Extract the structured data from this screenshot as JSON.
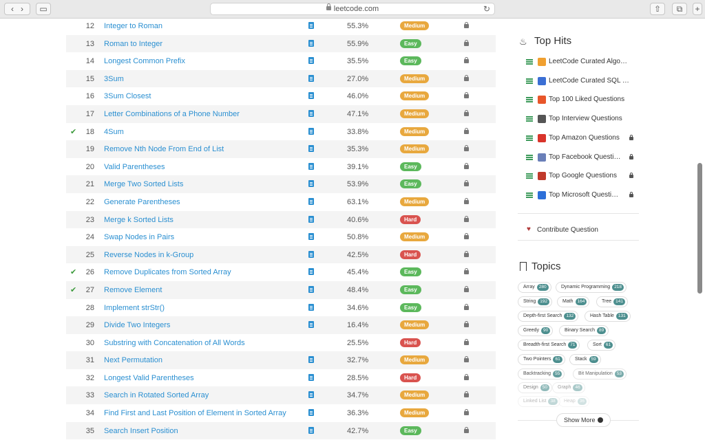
{
  "browser": {
    "url": "leetcode.com"
  },
  "problems": [
    {
      "num": "12",
      "title": "Integer to Roman",
      "acceptance": "55.3%",
      "difficulty": "Medium",
      "solved": false,
      "solution": true
    },
    {
      "num": "13",
      "title": "Roman to Integer",
      "acceptance": "55.9%",
      "difficulty": "Easy",
      "solved": false,
      "solution": true
    },
    {
      "num": "14",
      "title": "Longest Common Prefix",
      "acceptance": "35.5%",
      "difficulty": "Easy",
      "solved": false,
      "solution": true
    },
    {
      "num": "15",
      "title": "3Sum",
      "acceptance": "27.0%",
      "difficulty": "Medium",
      "solved": false,
      "solution": true
    },
    {
      "num": "16",
      "title": "3Sum Closest",
      "acceptance": "46.0%",
      "difficulty": "Medium",
      "solved": false,
      "solution": true
    },
    {
      "num": "17",
      "title": "Letter Combinations of a Phone Number",
      "acceptance": "47.1%",
      "difficulty": "Medium",
      "solved": false,
      "solution": true
    },
    {
      "num": "18",
      "title": "4Sum",
      "acceptance": "33.8%",
      "difficulty": "Medium",
      "solved": true,
      "solution": true
    },
    {
      "num": "19",
      "title": "Remove Nth Node From End of List",
      "acceptance": "35.3%",
      "difficulty": "Medium",
      "solved": false,
      "solution": true
    },
    {
      "num": "20",
      "title": "Valid Parentheses",
      "acceptance": "39.1%",
      "difficulty": "Easy",
      "solved": false,
      "solution": true
    },
    {
      "num": "21",
      "title": "Merge Two Sorted Lists",
      "acceptance": "53.9%",
      "difficulty": "Easy",
      "solved": false,
      "solution": true
    },
    {
      "num": "22",
      "title": "Generate Parentheses",
      "acceptance": "63.1%",
      "difficulty": "Medium",
      "solved": false,
      "solution": true
    },
    {
      "num": "23",
      "title": "Merge k Sorted Lists",
      "acceptance": "40.6%",
      "difficulty": "Hard",
      "solved": false,
      "solution": true
    },
    {
      "num": "24",
      "title": "Swap Nodes in Pairs",
      "acceptance": "50.8%",
      "difficulty": "Medium",
      "solved": false,
      "solution": true
    },
    {
      "num": "25",
      "title": "Reverse Nodes in k-Group",
      "acceptance": "42.5%",
      "difficulty": "Hard",
      "solved": false,
      "solution": true
    },
    {
      "num": "26",
      "title": "Remove Duplicates from Sorted Array",
      "acceptance": "45.4%",
      "difficulty": "Easy",
      "solved": true,
      "solution": true
    },
    {
      "num": "27",
      "title": "Remove Element",
      "acceptance": "48.4%",
      "difficulty": "Easy",
      "solved": true,
      "solution": true
    },
    {
      "num": "28",
      "title": "Implement strStr()",
      "acceptance": "34.6%",
      "difficulty": "Easy",
      "solved": false,
      "solution": true
    },
    {
      "num": "29",
      "title": "Divide Two Integers",
      "acceptance": "16.4%",
      "difficulty": "Medium",
      "solved": false,
      "solution": true
    },
    {
      "num": "30",
      "title": "Substring with Concatenation of All Words",
      "acceptance": "25.5%",
      "difficulty": "Hard",
      "solved": false,
      "solution": false
    },
    {
      "num": "31",
      "title": "Next Permutation",
      "acceptance": "32.7%",
      "difficulty": "Medium",
      "solved": false,
      "solution": true
    },
    {
      "num": "32",
      "title": "Longest Valid Parentheses",
      "acceptance": "28.5%",
      "difficulty": "Hard",
      "solved": false,
      "solution": true
    },
    {
      "num": "33",
      "title": "Search in Rotated Sorted Array",
      "acceptance": "34.7%",
      "difficulty": "Medium",
      "solved": false,
      "solution": true
    },
    {
      "num": "34",
      "title": "Find First and Last Position of Element in Sorted Array",
      "acceptance": "36.3%",
      "difficulty": "Medium",
      "solved": false,
      "solution": true
    },
    {
      "num": "35",
      "title": "Search Insert Position",
      "acceptance": "42.7%",
      "difficulty": "Easy",
      "solved": false,
      "solution": true
    }
  ],
  "sidebar": {
    "top_hits_title": "Top Hits",
    "top_hits": [
      {
        "label": "LeetCode Curated Algo…",
        "icon": "orange-diamond-icon",
        "color": "#f0a030",
        "locked": false
      },
      {
        "label": "LeetCode Curated SQL …",
        "icon": "blue-diamond-icon",
        "color": "#3b6fd4",
        "locked": false
      },
      {
        "label": "Top 100 Liked Questions",
        "icon": "fire-icon",
        "color": "#e8562a",
        "locked": false
      },
      {
        "label": "Top Interview Questions",
        "icon": "top-arrow-icon",
        "color": "#555555",
        "locked": false
      },
      {
        "label": "Top Amazon Questions",
        "icon": "amazon-icon",
        "color": "#d9342b",
        "locked": true
      },
      {
        "label": "Top Facebook Questi…",
        "icon": "facebook-icon",
        "color": "#6a7fb8",
        "locked": true
      },
      {
        "label": "Top Google Questions",
        "icon": "google-icon",
        "color": "#c0392b",
        "locked": true
      },
      {
        "label": "Top Microsoft Questi…",
        "icon": "microsoft-icon",
        "color": "#2d6fd8",
        "locked": true
      }
    ],
    "contribute": "Contribute Question",
    "topics_title": "Topics",
    "topics": [
      {
        "name": "Array",
        "count": "280"
      },
      {
        "name": "Dynamic Programming",
        "count": "218"
      },
      {
        "name": "String",
        "count": "192"
      },
      {
        "name": "Math",
        "count": "164"
      },
      {
        "name": "Tree",
        "count": "141"
      },
      {
        "name": "Depth-first Search",
        "count": "132"
      },
      {
        "name": "Hash Table",
        "count": "131"
      },
      {
        "name": "Greedy",
        "count": "90"
      },
      {
        "name": "Binary Search",
        "count": "89"
      },
      {
        "name": "Breadth-first Search",
        "count": "71"
      },
      {
        "name": "Sort",
        "count": "61"
      },
      {
        "name": "Two Pointers",
        "count": "61"
      },
      {
        "name": "Stack",
        "count": "59"
      },
      {
        "name": "Backtracking",
        "count": "55"
      },
      {
        "name": "Bit Manipulation",
        "count": "53"
      },
      {
        "name": "Design",
        "count": "50"
      },
      {
        "name": "Graph",
        "count": "46"
      },
      {
        "name": "Linked List",
        "count": "38"
      },
      {
        "name": "Heap",
        "count": "36"
      }
    ],
    "show_more": "Show More"
  }
}
